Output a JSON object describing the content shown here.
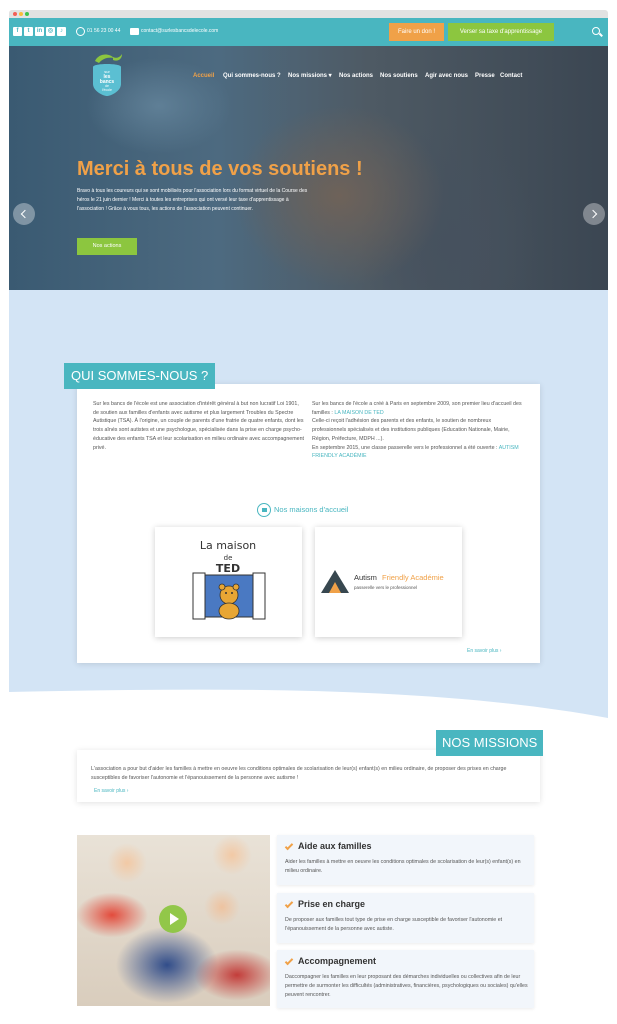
{
  "topbar": {
    "social": [
      {
        "name": "facebook",
        "glyph": "f"
      },
      {
        "name": "twitter",
        "glyph": "t"
      },
      {
        "name": "linkedin",
        "glyph": "in"
      },
      {
        "name": "instagram",
        "glyph": "◎"
      },
      {
        "name": "tiktok",
        "glyph": "♪"
      }
    ],
    "phone": "01 56 23 00 44",
    "email": "contact@surlesbancsdelecole.com",
    "don_label": "Faire un don !",
    "taxe_label": "Verser sa taxe d'apprentissage"
  },
  "logo": {
    "line1": "sur",
    "line2": "les",
    "line3": "bancs",
    "line4": "de",
    "line5": "l'école"
  },
  "nav": [
    "Accueil",
    "Qui sommes-nous ?",
    "Nos missions",
    "Nos actions",
    "Nos soutiens",
    "Agir avec nous",
    "Presse",
    "Contact"
  ],
  "hero": {
    "title": "Merci à tous de vos soutiens !",
    "text": "Bravo à tous les coureurs qui se sont mobilisés pour l'association lors du format virtuel de la Course des héros le 21 juin dernier ! Merci à toutes les entreprises qui ont versé leur taxe d'apprentissage à l'association ! Grâce à vous tous, les actions de l'association peuvent continuer.",
    "button": "Nos actions"
  },
  "about": {
    "title": "QUI SOMMES-NOUS ?",
    "left": "Sur les bancs de l'école est une association d'intérêt général à but non lucratif Loi 1901, de soutien aux familles d'enfants avec autisme et plus largement Troubles du Spectre Autistique (TSA). À l'origine, un couple de parents d'une fratrie de quatre enfants, dont les trois aînés sont autistes et une psychologue, spécialisée dans la prise en charge psycho-éducative des enfants TSA et leur scolarisation en milieu ordinaire avec accompagnement privé.",
    "right_p1": "Sur les bancs de l'école a créé à Paris en septembre 2009, son premier lieu d'accueil des familles :",
    "right_link1": "LA MAISON DE TED",
    "right_p2": "Celle-ci reçoit l'adhésion des parents et des enfants, le soutien de nombreux professionnels spécialisés et des institutions publiques (Education Nationale, Mairie, Région, Préfecture, MDPH ...).",
    "right_p3": "En septembre 2015, une classe passerelle vers le professionnel a été ouverte :",
    "right_link2": "AUTISM FRIENDLY ACADÉMIE",
    "maisons_heading": "Nos maisons d'accueil",
    "maison1": {
      "line1": "La maison",
      "line2": "de",
      "line3": "TED"
    },
    "maison2": {
      "name_a": "Autism",
      "name_b": "Friendly Académie",
      "tagline": "passerelle vers le professionnel"
    },
    "more": "En savoir plus  ›"
  },
  "missions": {
    "title": "NOS MISSIONS",
    "text": "L'association a pour but d'aider les familles à mettre en oeuvre les conditions optimales de scolarisation de leur(s) enfant(s) en milieu ordinaire, de proposer des prises en charge susceptibles de favoriser l'autonomie et l'épanouissement de la personne avec autisme !",
    "more": "En savoir plus  ›"
  },
  "boxes": [
    {
      "title": "Aide aux familles",
      "text": "Aider les familles à mettre en oeuvre les conditions optimales de scolarisation de leur(s) enfant(s) en milieu ordinaire."
    },
    {
      "title": "Prise en charge",
      "text": "De proposer aux familles tout type de prise en charge susceptible de favoriser l'autonomie et l'épanouissement de la personne avec autiste."
    },
    {
      "title": "Accompagnement",
      "text": "Daccompagner les familles en leur proposant des démarches individuelles ou collectives afin de leur permettre de surmonter les difficultés (administratives, financières, psychologiques ou sociales) qu'elles peuvent rencontrer."
    }
  ],
  "colors": {
    "teal": "#49b6c0",
    "orange": "#f0a148",
    "green": "#8cc63f",
    "band": "#d3e4f5"
  }
}
